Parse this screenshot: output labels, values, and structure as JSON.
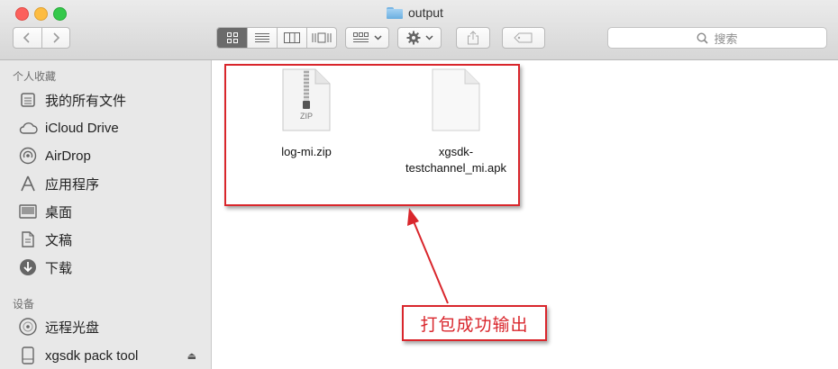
{
  "window": {
    "title": "output",
    "title_icon": "folder-icon"
  },
  "toolbar": {
    "back_icon": "chevron-left-icon",
    "forward_icon": "chevron-right-icon",
    "view_modes": [
      "icon-view",
      "list-view",
      "column-view",
      "cover-flow-view"
    ],
    "active_view": "icon-view",
    "arrange_icon": "arrange-icon",
    "action_icon": "gear-icon",
    "share_icon": "share-icon",
    "tag_icon": "tag-icon",
    "search_placeholder": "搜索"
  },
  "sidebar": {
    "favorites_header": "个人收藏",
    "favorites": [
      {
        "label": "我的所有文件",
        "icon": "all-files-icon"
      },
      {
        "label": "iCloud Drive",
        "icon": "cloud-icon"
      },
      {
        "label": "AirDrop",
        "icon": "airdrop-icon"
      },
      {
        "label": "应用程序",
        "icon": "applications-icon"
      },
      {
        "label": "桌面",
        "icon": "desktop-icon"
      },
      {
        "label": "文稿",
        "icon": "documents-icon"
      },
      {
        "label": "下载",
        "icon": "download-icon"
      }
    ],
    "devices_header": "设备",
    "devices": [
      {
        "label": "远程光盘",
        "icon": "disc-icon"
      },
      {
        "label": "xgsdk pack tool",
        "icon": "drive-icon",
        "eject": "eject-icon"
      }
    ]
  },
  "files": [
    {
      "name": "log-mi.zip",
      "type": "zip",
      "badge": "ZIP"
    },
    {
      "name": "xgsdk-\ntestchannel_mi.apk",
      "type": "apk"
    }
  ],
  "annotation": {
    "label": "打包成功输出",
    "color": "#d9262c"
  }
}
